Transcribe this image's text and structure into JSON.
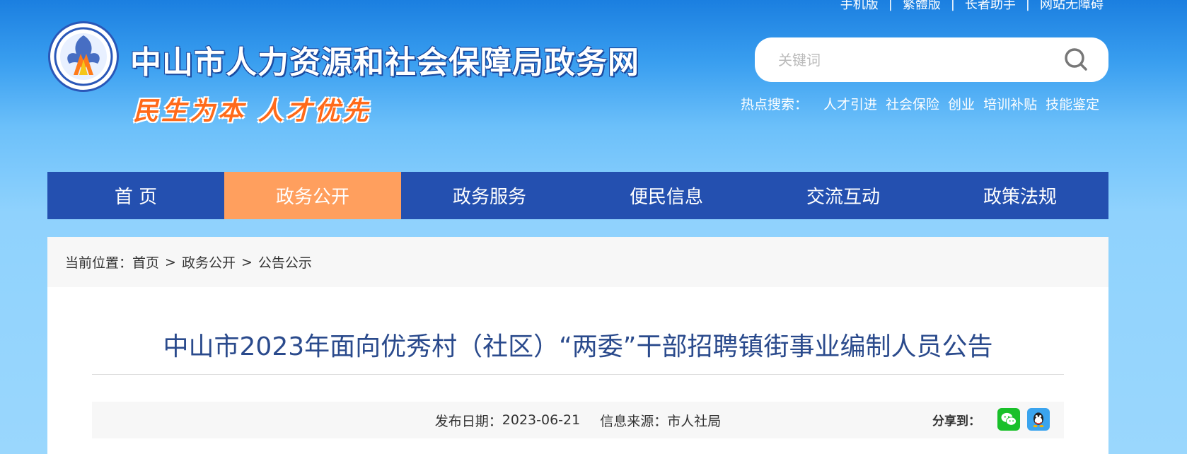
{
  "top_links": [
    "手机版",
    "繁體版",
    "长者助手",
    "网站无障碍"
  ],
  "header": {
    "site_title": "中山市人力资源和社会保障局政务网",
    "slogan": "民生为本 人才优先"
  },
  "search": {
    "placeholder": "关键词",
    "hot_label": "热点搜索：",
    "hot_terms": [
      "人才引进",
      "社会保险",
      "创业",
      "培训补贴",
      "技能鉴定"
    ]
  },
  "nav": {
    "items": [
      "首 页",
      "政务公开",
      "政务服务",
      "便民信息",
      "交流互动",
      "政策法规"
    ],
    "active_index": 1
  },
  "breadcrumb": {
    "label": "当前位置：",
    "items": [
      "首页",
      "政务公开",
      "公告公示"
    ],
    "separator": ">"
  },
  "article": {
    "title": "中山市2023年面向优秀村（社区）“两委”干部招聘镇街事业编制人员公告",
    "date_label": "发布日期：",
    "date": "2023-06-21",
    "source_label": "信息来源：",
    "source": "市人社局",
    "share_label": "分享到："
  },
  "colors": {
    "nav_bg": "#2450b0",
    "nav_active": "#ff9f5e",
    "title": "#2a4a8c"
  }
}
